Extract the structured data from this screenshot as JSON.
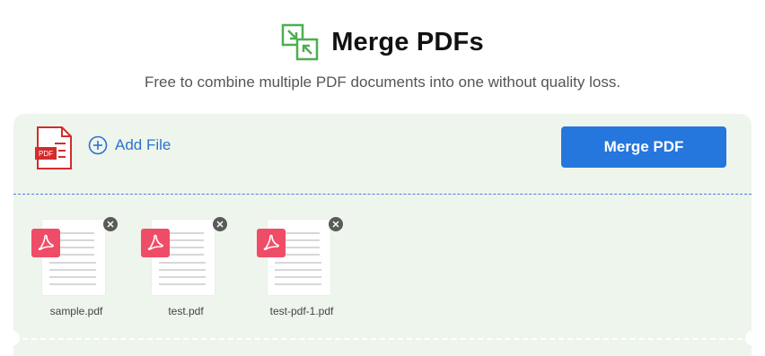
{
  "header": {
    "title": "Merge PDFs",
    "logo_icon": "merge-arrows-icon",
    "subtitle": "Free to combine multiple PDF documents into one without quality loss."
  },
  "toolbar": {
    "pdf_icon_label": "PDF",
    "add_file_label": "Add File",
    "merge_label": "Merge PDF"
  },
  "files": [
    {
      "name": "sample.pdf"
    },
    {
      "name": "test.pdf"
    },
    {
      "name": "test-pdf-1.pdf"
    }
  ],
  "colors": {
    "accent": "#2576dd",
    "panel_bg": "#eef5ec",
    "pdf_red": "#ef4d67",
    "logo_green": "#4caf50"
  }
}
